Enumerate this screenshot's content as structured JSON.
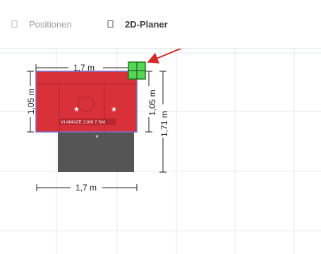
{
  "tabs": [
    {
      "label": "Positionen",
      "icon": "square-icon"
    },
    {
      "label": "2D-Planer",
      "icon": "square-icon"
    }
  ],
  "planner": {
    "object_label": "VI AMAZE 2169 7.5AI",
    "dim_top_width": "1,7 m",
    "dim_bottom_width": "1,7 m",
    "dim_left_height": "1,05 m",
    "dim_right_inner_height": "1,05 m",
    "dim_right_outer_height": "1,71 m"
  },
  "colors": {
    "object_red": "#d9313a",
    "object_dark": "#555555",
    "handle_green": "#55d655",
    "arrow_red": "#d42a2a",
    "grid": "#e6e8eb"
  }
}
